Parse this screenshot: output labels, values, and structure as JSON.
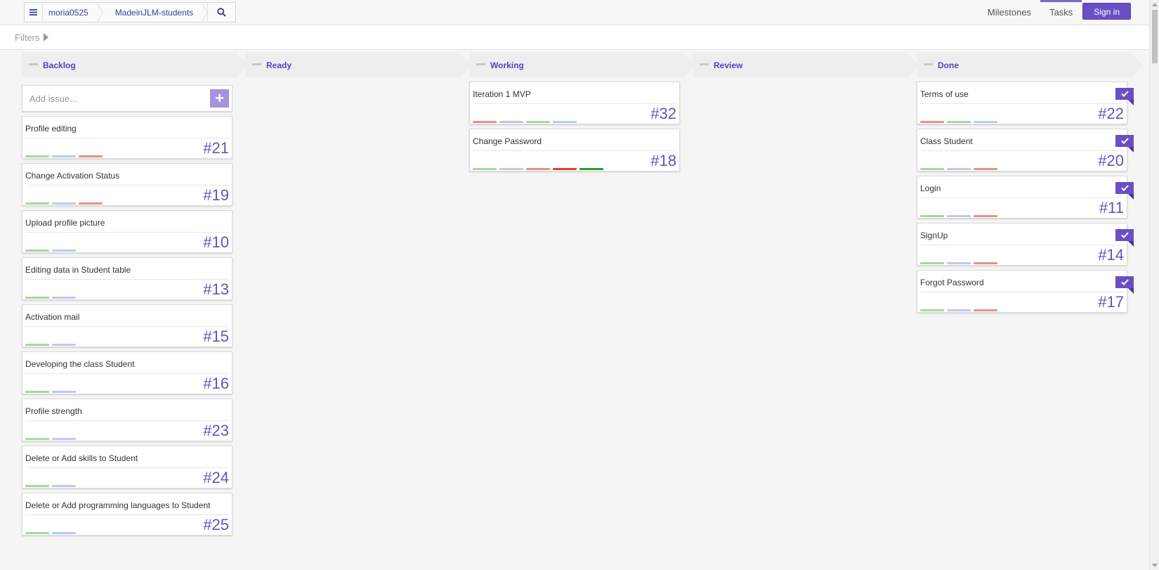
{
  "nav": {
    "breadcrumb": [
      "moria0525",
      "MadeinJLM-students"
    ],
    "links": [
      "Milestones",
      "Tasks"
    ],
    "active_link": "Tasks",
    "signin_label": "Sign in"
  },
  "filters": {
    "label": "Filters"
  },
  "colors": {
    "accent": "#6a4fc4",
    "label_green": "#a9d6a5",
    "label_blue": "#b8cdee",
    "label_red": "#e8908b",
    "label_purple": "#cbbcea",
    "label_bright_red": "#e53935",
    "label_dark_green": "#2e9a2e"
  },
  "columns": [
    {
      "title": "Backlog",
      "add_placeholder": "Add issue...",
      "cards": [
        {
          "title": "Profile editing",
          "number": "#21",
          "labels": [
            "green",
            "blue",
            "red"
          ],
          "done": false
        },
        {
          "title": "Change Activation Status",
          "number": "#19",
          "labels": [
            "green",
            "blue",
            "red"
          ],
          "done": false
        },
        {
          "title": "Upload profile picture",
          "number": "#10",
          "labels": [
            "green",
            "blue"
          ],
          "done": false
        },
        {
          "title": "Editing data in Student table",
          "number": "#13",
          "labels": [
            "green",
            "blue"
          ],
          "done": false
        },
        {
          "title": "Activation mail",
          "number": "#15",
          "labels": [
            "green",
            "blue"
          ],
          "done": false
        },
        {
          "title": "Developing the class Student",
          "number": "#16",
          "labels": [
            "green",
            "blue"
          ],
          "done": false
        },
        {
          "title": "Profile strength",
          "number": "#23",
          "labels": [
            "green",
            "blue"
          ],
          "done": false
        },
        {
          "title": "Delete or Add skills to Student",
          "number": "#24",
          "labels": [
            "green",
            "blue"
          ],
          "done": false
        },
        {
          "title": "Delete or Add programming languages to Student",
          "number": "#25",
          "labels": [
            "green",
            "blue"
          ],
          "done": false
        }
      ]
    },
    {
      "title": "Ready",
      "cards": []
    },
    {
      "title": "Working",
      "cards": [
        {
          "title": "Iteration 1 MVP",
          "number": "#32",
          "labels": [
            "red",
            "purple",
            "green",
            "blue"
          ],
          "done": false
        },
        {
          "title": "Change Password",
          "number": "#18",
          "labels": [
            "green",
            "blue",
            "red",
            "bright_red",
            "dark_green"
          ],
          "done": false
        }
      ]
    },
    {
      "title": "Review",
      "cards": []
    },
    {
      "title": "Done",
      "cards": [
        {
          "title": "Terms of use",
          "number": "#22",
          "labels": [
            "red",
            "green",
            "blue"
          ],
          "done": true
        },
        {
          "title": "Class Student",
          "number": "#20",
          "labels": [
            "green",
            "blue",
            "red"
          ],
          "done": true
        },
        {
          "title": "Login",
          "number": "#11",
          "labels": [
            "green",
            "blue",
            "red"
          ],
          "done": true
        },
        {
          "title": "SignUp",
          "number": "#14",
          "labels": [
            "green",
            "blue",
            "red"
          ],
          "done": true
        },
        {
          "title": "Forgot Password",
          "number": "#17",
          "labels": [
            "green",
            "blue",
            "red"
          ],
          "done": true
        }
      ]
    }
  ]
}
